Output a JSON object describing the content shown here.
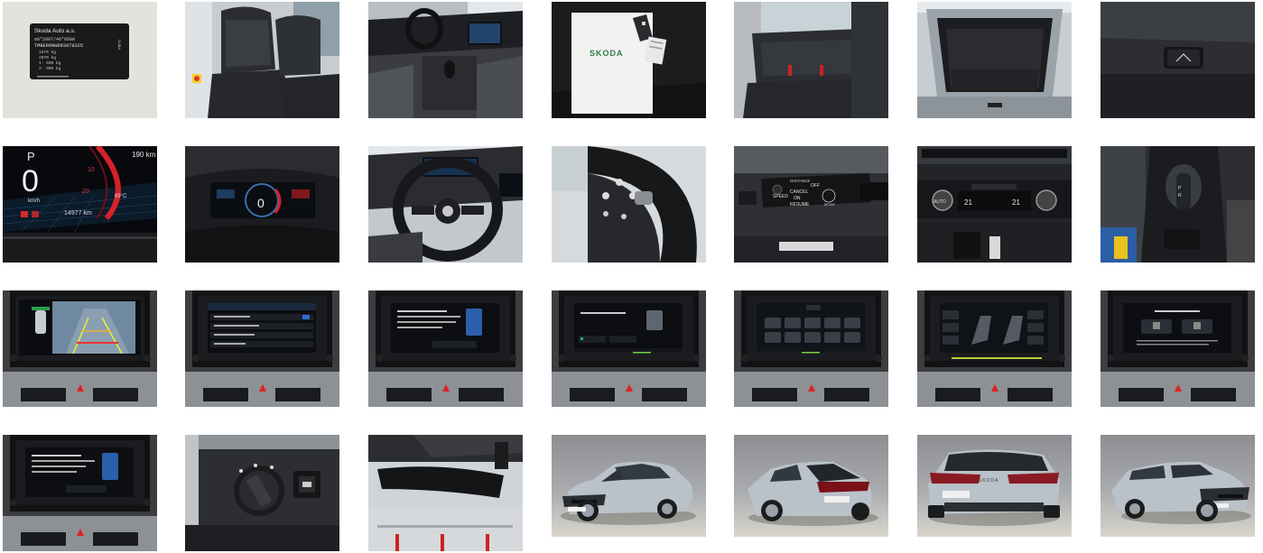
{
  "gallery": {
    "items": [
      {
        "label": "VIN plate",
        "icon": "vin-plate-photo",
        "text": {
          "maker": "Skoda Auto a.s.",
          "code": "e8*2007/46*0508",
          "vin": "TMBER9NW8R3078325",
          "w1": "1870 kg",
          "w2": "2870 kg",
          "w3": "1- 930 kg",
          "w4": "2- 990 kg",
          "side": "DUBA"
        }
      },
      {
        "label": "Front seats",
        "icon": "front-seats-photo"
      },
      {
        "label": "Interior dashboard",
        "icon": "interior-dashboard-photo"
      },
      {
        "label": "Keys and manual",
        "icon": "keys-manual-photo",
        "text": {
          "brand": "SKODA"
        }
      },
      {
        "label": "Rear seats",
        "icon": "rear-seats-photo"
      },
      {
        "label": "Trunk",
        "icon": "trunk-photo"
      },
      {
        "label": "Tailgate button",
        "icon": "tailgate-button-photo"
      },
      {
        "label": "Digital speedometer",
        "icon": "speedometer-photo",
        "text": {
          "gear": "P",
          "speed": "0",
          "unit": "km/h",
          "max": "190 km",
          "temp": "69°C",
          "odo": "14977 km",
          "r1": "10",
          "r2": "20"
        }
      },
      {
        "label": "Instrument cluster",
        "icon": "instrument-cluster-photo",
        "text": {
          "speed": "0"
        }
      },
      {
        "label": "Steering wheel",
        "icon": "steering-wheel-photo"
      },
      {
        "label": "Steering wheel buttons",
        "icon": "steering-buttons-photo"
      },
      {
        "label": "Cruise control stalk",
        "icon": "cruise-stalk-photo",
        "text": {
          "distance": "DISTANCE",
          "speed": "SPEED",
          "off": "OFF",
          "cancel": "CANCEL",
          "on": "ON",
          "resume": "RESUME",
          "mode": "MODE"
        }
      },
      {
        "label": "Climate control",
        "icon": "climate-control-photo",
        "text": {
          "left": "21",
          "right": "21",
          "auto": "AUTO"
        }
      },
      {
        "label": "Gear shifter",
        "icon": "gear-shifter-photo"
      },
      {
        "label": "Parking camera screen",
        "icon": "parking-camera-photo"
      },
      {
        "label": "Infotainment settings",
        "icon": "infotainment-settings-photo"
      },
      {
        "label": "Infotainment message",
        "icon": "infotainment-message-photo"
      },
      {
        "label": "Infotainment menu",
        "icon": "infotainment-menu-photo"
      },
      {
        "label": "Infotainment apps",
        "icon": "infotainment-apps-photo"
      },
      {
        "label": "Infotainment seats",
        "icon": "infotainment-seats-photo"
      },
      {
        "label": "Infotainment connect",
        "icon": "infotainment-connect-photo"
      },
      {
        "label": "Infotainment phone",
        "icon": "infotainment-phone-photo"
      },
      {
        "label": "Light switch",
        "icon": "light-switch-photo"
      },
      {
        "label": "Rear view mirror",
        "icon": "rear-view-mirror-photo"
      },
      {
        "label": "Front three-quarter exterior",
        "icon": "exterior-front-left-photo"
      },
      {
        "label": "Rear left exterior",
        "icon": "exterior-rear-left-photo"
      },
      {
        "label": "Rear exterior",
        "icon": "exterior-rear-photo",
        "text": {
          "badge": "SKODA"
        }
      },
      {
        "label": "Front right exterior",
        "icon": "exterior-front-right-photo"
      }
    ]
  },
  "colors": {
    "screen_blue": "#2a5fa8",
    "accent_red": "#e0141e",
    "car_silver": "#b9c1c9",
    "dash_black": "#15171a"
  }
}
